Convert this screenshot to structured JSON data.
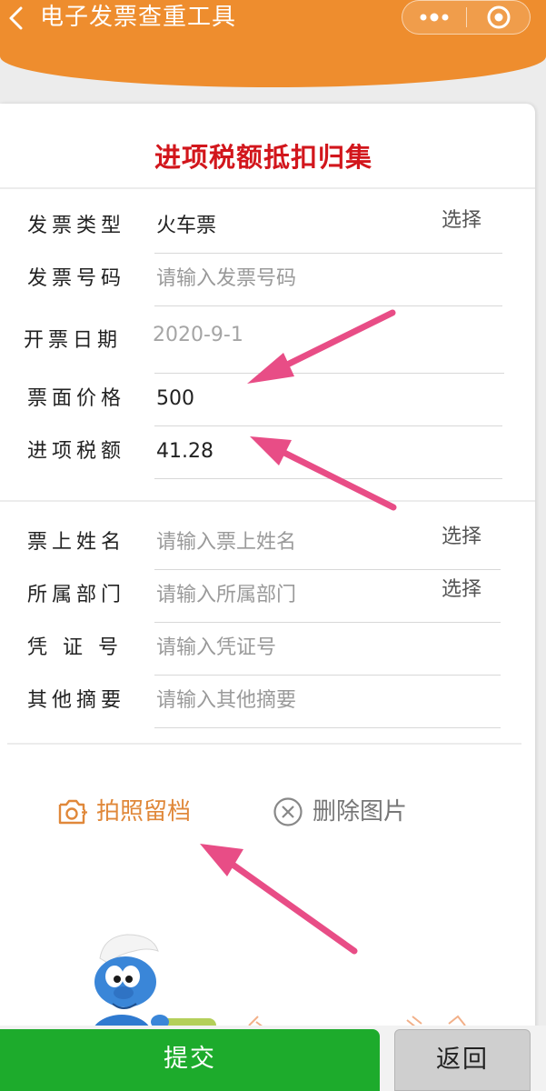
{
  "header": {
    "title": "电子发票查重工具",
    "icons": [
      "back-chevron",
      "more-dots",
      "close-circle"
    ],
    "bg_color": "#ee8d2e"
  },
  "form": {
    "title": "进项税额抵扣归集",
    "title_color": "#d2161c",
    "section1": [
      {
        "label": "发票类型",
        "value": "火车票",
        "placeholder": false,
        "action": "选择"
      },
      {
        "label": "发票号码",
        "value": "请输入发票号码",
        "placeholder": true,
        "action": ""
      },
      {
        "label": "开票日期",
        "value": "2020-9-1",
        "placeholder": true,
        "action": ""
      },
      {
        "label": "票面价格",
        "value": "500",
        "placeholder": false,
        "action": ""
      },
      {
        "label": "进项税额",
        "value": "41.28",
        "placeholder": false,
        "action": ""
      }
    ],
    "section2": [
      {
        "label": "票上姓名",
        "value": "请输入票上姓名",
        "placeholder": true,
        "action": "选择"
      },
      {
        "label": "所属部门",
        "value": "请输入所属部门",
        "placeholder": true,
        "action": "选择"
      },
      {
        "label": "凭 证 号",
        "value": "请输入凭证号",
        "placeholder": true,
        "action": ""
      },
      {
        "label": "其他摘要",
        "value": "请输入其他摘要",
        "placeholder": true,
        "action": ""
      }
    ]
  },
  "media": {
    "photo_label": "拍照留档",
    "delete_label": "删除图片",
    "photo_color": "#e0883a"
  },
  "footer": {
    "submit_label": "提交",
    "back_label": "返回",
    "submit_color": "#1dab2c"
  },
  "annotation_color": "#e84d86"
}
